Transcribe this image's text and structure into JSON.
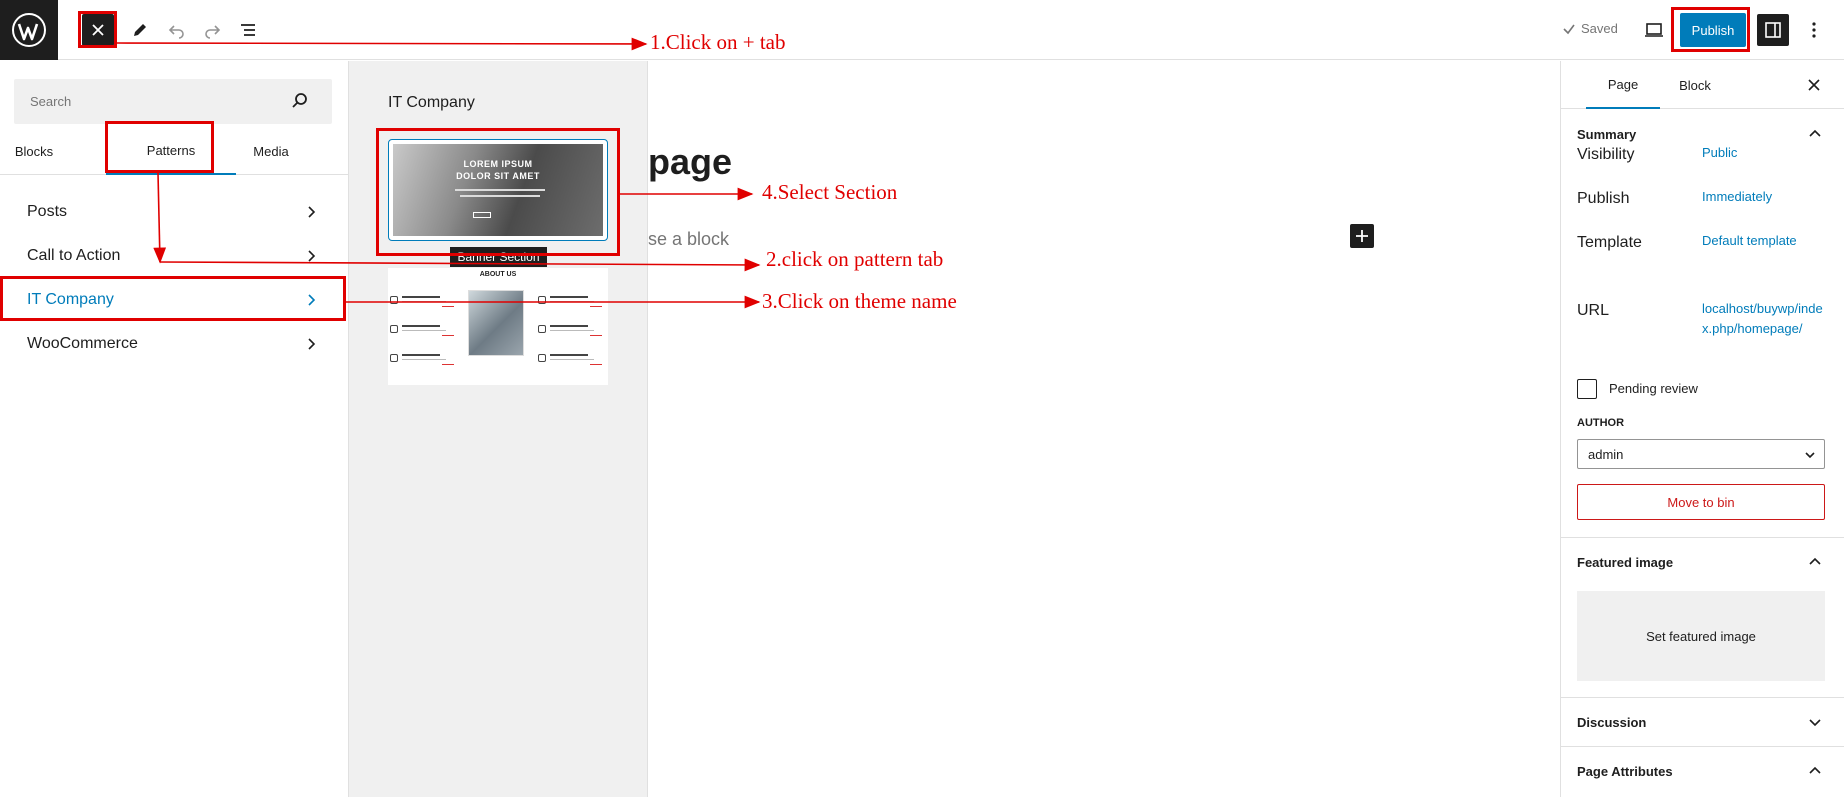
{
  "topbar": {
    "saved_label": "Saved",
    "publish_label": "Publish"
  },
  "inserter": {
    "search_placeholder": "Search",
    "tabs": [
      {
        "label": "Blocks"
      },
      {
        "label": "Patterns"
      },
      {
        "label": "Media"
      }
    ],
    "categories": [
      {
        "label": "Posts"
      },
      {
        "label": "Call to Action"
      },
      {
        "label": "IT Company"
      },
      {
        "label": "WooCommerce"
      }
    ]
  },
  "pattern_panel": {
    "title": "IT Company",
    "banner_text_line1": "LOREM IPSUM",
    "banner_text_line2": "DOLOR SIT AMET",
    "tooltip": "Banner Section",
    "about_title": "ABOUT US"
  },
  "canvas": {
    "title_fragment": "page",
    "block_hint": "se a block"
  },
  "sidebar": {
    "tabs": [
      {
        "label": "Page"
      },
      {
        "label": "Block"
      }
    ],
    "summary_label": "Summary",
    "visibility_label": "Visibility",
    "visibility_value": "Public",
    "publish_label": "Publish",
    "publish_value": "Immediately",
    "template_label": "Template",
    "template_value": "Default template",
    "url_label": "URL",
    "url_value": "localhost/buywp/index.php/homepage/",
    "pending_label": "Pending review",
    "author_label": "AUTHOR",
    "author_value": "admin",
    "move_bin_label": "Move to bin",
    "featured_label": "Featured image",
    "set_featured_label": "Set featured image",
    "discussion_label": "Discussion",
    "page_attributes_label": "Page Attributes"
  },
  "annotations": {
    "step1": "1.Click on + tab",
    "step2": "2.click on pattern tab",
    "step3": "3.Click on theme name",
    "step4": "4.Select Section"
  },
  "colors": {
    "accent": "#007cba",
    "annotation": "#e00000",
    "danger": "#cc1818",
    "dark": "#1e1e1e"
  }
}
